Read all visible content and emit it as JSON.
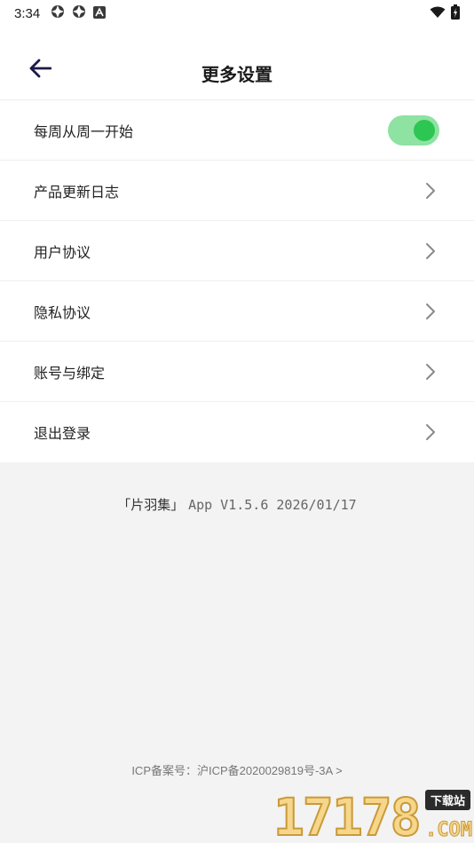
{
  "status_bar": {
    "time": "3:34"
  },
  "header": {
    "title": "更多设置"
  },
  "settings": {
    "items": [
      {
        "label": "每周从周一开始",
        "control": "toggle",
        "on": true
      },
      {
        "label": "产品更新日志",
        "control": "chevron"
      },
      {
        "label": "用户协议",
        "control": "chevron"
      },
      {
        "label": "隐私协议",
        "control": "chevron"
      },
      {
        "label": "账号与绑定",
        "control": "chevron"
      },
      {
        "label": "退出登录",
        "control": "chevron"
      }
    ]
  },
  "version": {
    "app_name": "「片羽集」",
    "details": "App V1.5.6 2026/01/17"
  },
  "footer": {
    "icp": "ICP备案号：沪ICP备2020029819号-3A >"
  },
  "watermark": {
    "digits": "17178",
    "badge": "下载站",
    "domain": ".COM"
  },
  "colors": {
    "toggle_track": "#8ee2a2",
    "toggle_knob": "#2dc653",
    "back_arrow": "#1c1a4a",
    "page_background": "#f3f3f3"
  }
}
